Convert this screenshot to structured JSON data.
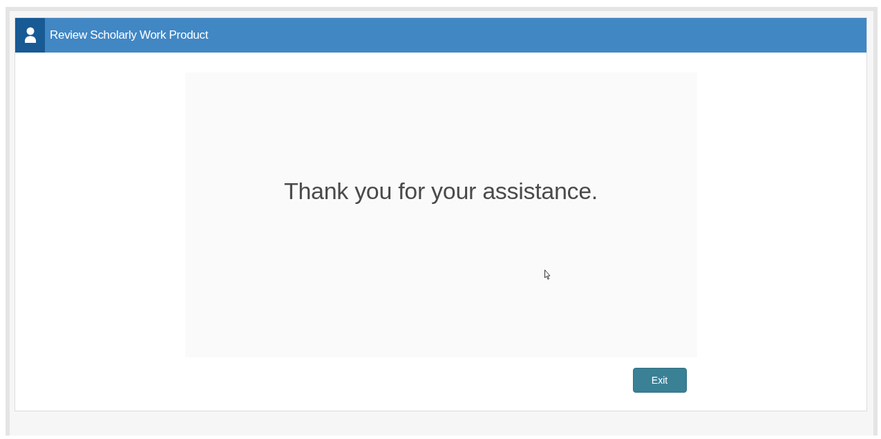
{
  "header": {
    "title": "Review Scholarly Work Product"
  },
  "message": "Thank you for your assistance.",
  "buttons": [
    {
      "label": "Exit"
    }
  ]
}
